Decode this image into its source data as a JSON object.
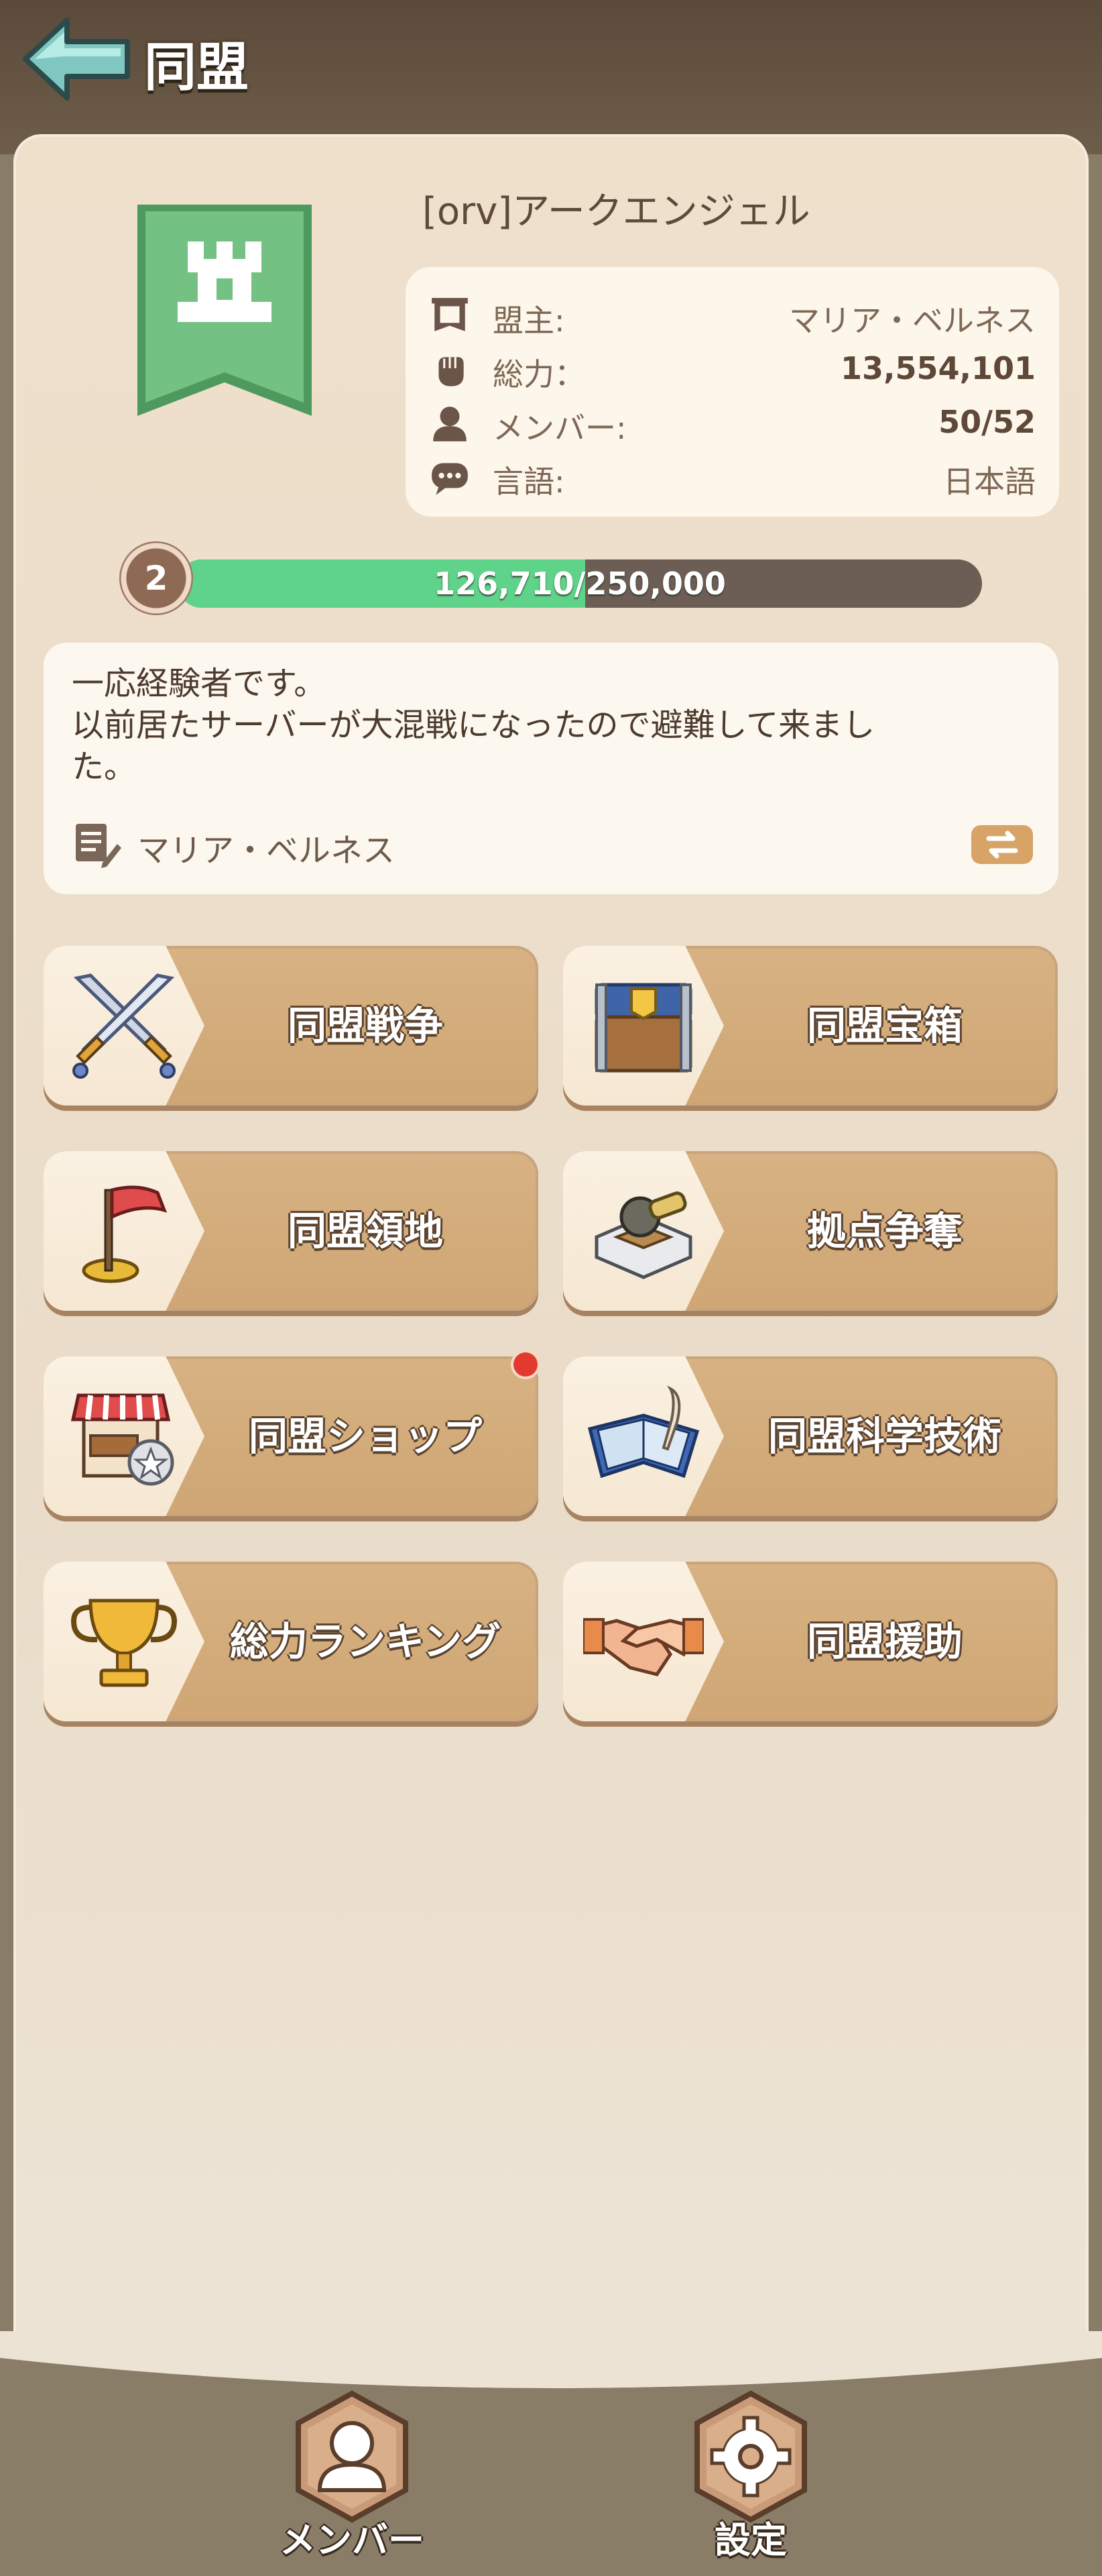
{
  "header": {
    "title": "同盟"
  },
  "alliance": {
    "name": "[orv]アークエンジェル",
    "info": [
      {
        "label": "盟主:",
        "value": "マリア・ベルネス",
        "icon": "banner-icon"
      },
      {
        "label": "総力：",
        "value": "13,554,101",
        "icon": "fist-icon"
      },
      {
        "label": "メンバー:",
        "value": "50/52",
        "icon": "person-icon"
      },
      {
        "label": "言語:",
        "value": "日本語",
        "icon": "chat-icon"
      }
    ],
    "level": "2",
    "xp": {
      "current": 126710,
      "max": 250000,
      "text": "126,710/250,000"
    },
    "description": {
      "line1": "一応経験者です。",
      "line2": "以前居たサーバーが大混戦になったので避難して来まし",
      "line3": "た。",
      "author": "マリア・ベルネス"
    }
  },
  "features": [
    {
      "label": "同盟戦争",
      "icon": "crossed-swords-icon"
    },
    {
      "label": "同盟宝箱",
      "icon": "treasure-chest-icon"
    },
    {
      "label": "同盟領地",
      "icon": "red-flag-icon"
    },
    {
      "label": "拠点争奪",
      "icon": "fortress-cannon-icon"
    },
    {
      "label": "同盟ショップ",
      "icon": "shop-icon",
      "notification": true
    },
    {
      "label": "同盟科学技術",
      "icon": "tech-book-icon"
    },
    {
      "label": "総力ランキング",
      "icon": "trophy-icon"
    },
    {
      "label": "同盟援助",
      "icon": "handshake-icon"
    }
  ],
  "bottom_nav": {
    "members_label": "メンバー",
    "settings_label": "設定"
  },
  "colors": {
    "xp_fill": "#5fd38a",
    "flag_green": "#6fbf80",
    "notification": "#e33a2f"
  }
}
